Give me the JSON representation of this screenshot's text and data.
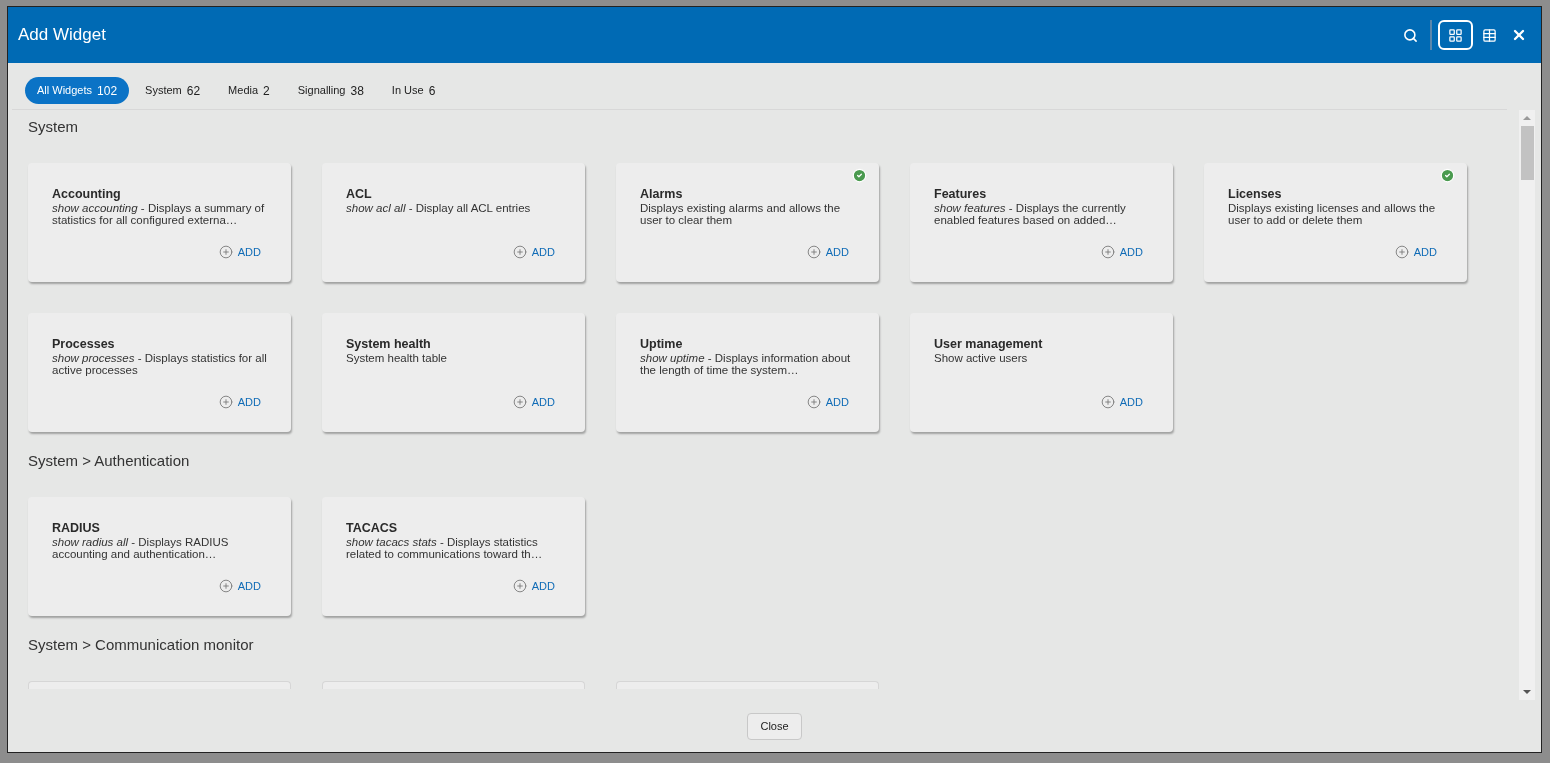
{
  "window": {
    "title": "Add Widget"
  },
  "toolbar": {
    "grid_view_selected": true
  },
  "tabs": [
    {
      "label": "All Widgets",
      "count": "102",
      "selected": true
    },
    {
      "label": "System",
      "count": "62",
      "selected": false
    },
    {
      "label": "Media",
      "count": "2",
      "selected": false
    },
    {
      "label": "Signalling",
      "count": "38",
      "selected": false
    },
    {
      "label": "In Use",
      "count": "6",
      "selected": false
    }
  ],
  "sections": [
    {
      "title": "System",
      "widgets": [
        {
          "kind": "card",
          "title": "Accounting",
          "description": "*show accounting* - Displays a summary of statistics for all configured externa…",
          "in_use": false,
          "action": "ADD"
        },
        {
          "kind": "card",
          "title": "ACL",
          "description": "*show acl all* - Display all ACL entries",
          "in_use": false,
          "action": "ADD"
        },
        {
          "kind": "card",
          "title": "Alarms",
          "description": "Displays existing alarms and allows the user to clear them",
          "in_use": true,
          "action": "ADD"
        },
        {
          "kind": "card",
          "title": "Features",
          "description": "*show features* - Displays the currently enabled features based on added…",
          "in_use": false,
          "action": "ADD"
        },
        {
          "kind": "card",
          "title": "Licenses",
          "description": "Displays existing licenses and allows the user to add or delete them",
          "in_use": true,
          "action": "ADD"
        },
        {
          "kind": "card",
          "title": "Processes",
          "description": "*show processes* - Displays statistics for all active processes",
          "in_use": false,
          "action": "ADD"
        },
        {
          "kind": "card",
          "title": "System health",
          "description": "System health table",
          "in_use": false,
          "action": "ADD"
        },
        {
          "kind": "card",
          "title": "Uptime",
          "description": "*show uptime* - Displays information about the length of time the system…",
          "in_use": false,
          "action": "ADD"
        },
        {
          "kind": "card",
          "title": "User management",
          "description": "Show active users",
          "in_use": false,
          "action": "ADD"
        }
      ]
    },
    {
      "title": "System > Authentication",
      "widgets": [
        {
          "kind": "card",
          "title": "RADIUS",
          "description": "*show radius all* - Displays RADIUS accounting and authentication…",
          "in_use": false,
          "action": "ADD"
        },
        {
          "kind": "card",
          "title": "TACACS",
          "description": "*show tacacs stats* - Displays statistics related to communications toward th…",
          "in_use": false,
          "action": "ADD"
        }
      ]
    },
    {
      "title": "System > Communication monitor",
      "widgets": [
        {
          "kind": "clipped"
        },
        {
          "kind": "clipped"
        },
        {
          "kind": "clipped"
        }
      ]
    }
  ],
  "footer": {
    "close_button": "Close"
  }
}
